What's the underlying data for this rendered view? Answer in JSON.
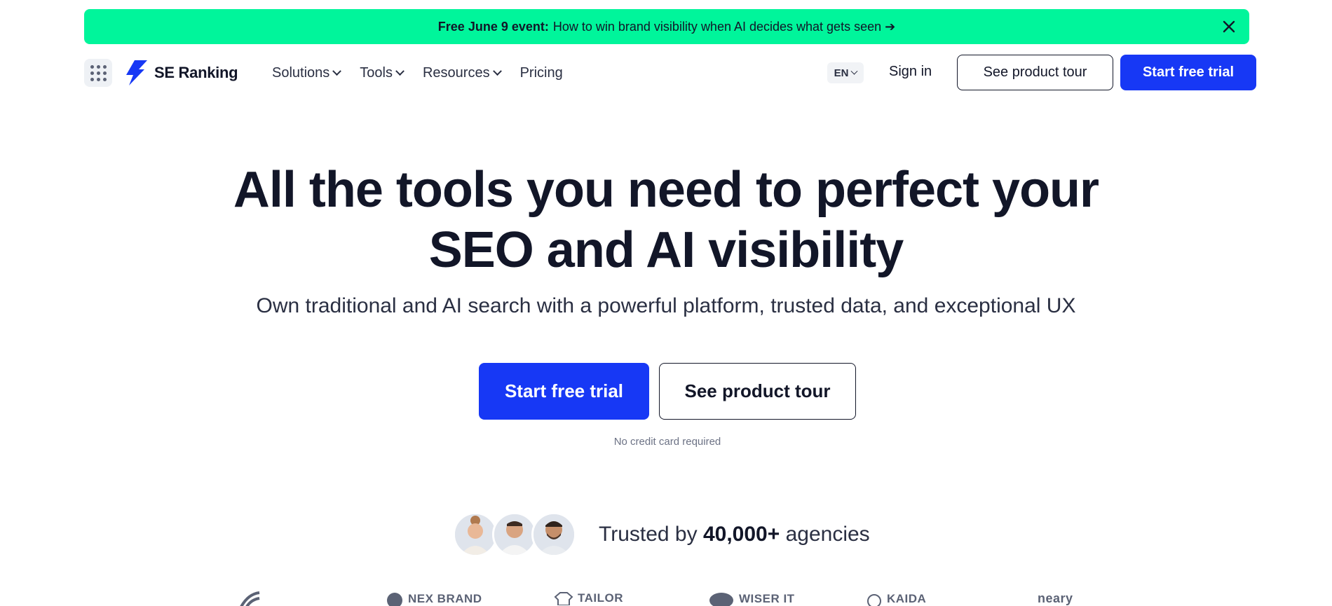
{
  "banner": {
    "lead": "Free June 9 event:",
    "text": "How to win brand visibility when AI decides what gets seen ➔",
    "bg_color": "#00f59b"
  },
  "header": {
    "brand": "SE Ranking",
    "nav": [
      {
        "label": "Solutions",
        "has_dropdown": true
      },
      {
        "label": "Tools",
        "has_dropdown": true
      },
      {
        "label": "Resources",
        "has_dropdown": true
      },
      {
        "label": "Pricing",
        "has_dropdown": false
      }
    ],
    "language": "EN",
    "sign_in": "Sign in",
    "tour_button": "See product tour",
    "trial_button": "Start free trial",
    "accent_color": "#1738f5"
  },
  "hero": {
    "title_line1": "All the tools you need to perfect your",
    "title_line2": "SEO and AI visibility",
    "subtitle": "Own traditional and AI search with a powerful platform, trusted data, and exceptional UX",
    "cta_primary": "Start free trial",
    "cta_secondary": "See product tour",
    "note": "No credit card required"
  },
  "trusted": {
    "prefix": "Trusted by",
    "count": "40,000+",
    "suffix": "agencies"
  },
  "logos": [
    "NEX BRAND",
    "TAILOR",
    "WISER IT",
    "KAIDA",
    "neary"
  ]
}
